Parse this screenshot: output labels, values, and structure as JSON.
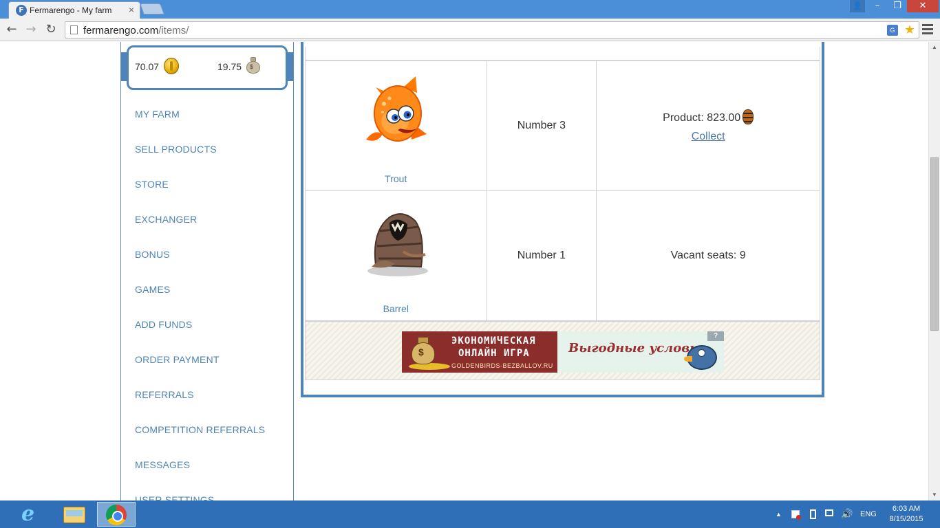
{
  "browser": {
    "tab_title": "Fermarengo - My farm",
    "tab_close": "×",
    "favicon_letter": "F",
    "url_host": "fermarengo.com",
    "url_path": "/items/",
    "window_min": "–",
    "window_max": "❐",
    "window_close": "✕",
    "user_icon": "👤",
    "nav_back": "←",
    "nav_forward": "→",
    "nav_reload": "↻",
    "translate_label": "G",
    "star": "★"
  },
  "balance": {
    "coins": "70.07",
    "money": "19.75",
    "money_icon_mark": "$"
  },
  "menu": [
    {
      "label": "MY FARM"
    },
    {
      "label": "SELL PRODUCTS"
    },
    {
      "label": "STORE"
    },
    {
      "label": "EXCHANGER"
    },
    {
      "label": "BONUS"
    },
    {
      "label": "GAMES"
    },
    {
      "label": "ADD FUNDS"
    },
    {
      "label": "ORDER PAYMENT"
    },
    {
      "label": "REFERRALS"
    },
    {
      "label": "COMPETITION REFERRALS"
    },
    {
      "label": "MESSAGES"
    },
    {
      "label": "USER SETTINGS"
    }
  ],
  "items": [
    {
      "name": "Trout",
      "number": "Number 3",
      "status_prefix": "Product: 823.00",
      "action": "Collect",
      "icon": "fish-icon"
    },
    {
      "name": "Barrel",
      "number": "Number 1",
      "status_prefix": "Vacant seats: 9",
      "action": "",
      "icon": "barrel-decoration-icon"
    }
  ],
  "banner": {
    "line1": "ЭКОНОМИЧЕСКАЯ",
    "line2": "ОНЛАЙН ИГРА",
    "line3": "GOLDENBIRDS-BEZBALLOV.RU",
    "slogan": "Выгодные условия",
    "bag_mark": "$",
    "help_mark": "?"
  },
  "taskbar": {
    "tray_arrow": "▲",
    "volume": "🔊",
    "language": "ENG",
    "time": "6:03 AM",
    "date": "8/15/2015"
  },
  "colors": {
    "accent": "#4f84b8",
    "link": "#4e84b6",
    "taskbar": "#2f6fb7",
    "titlebar": "#4a8fd8"
  }
}
